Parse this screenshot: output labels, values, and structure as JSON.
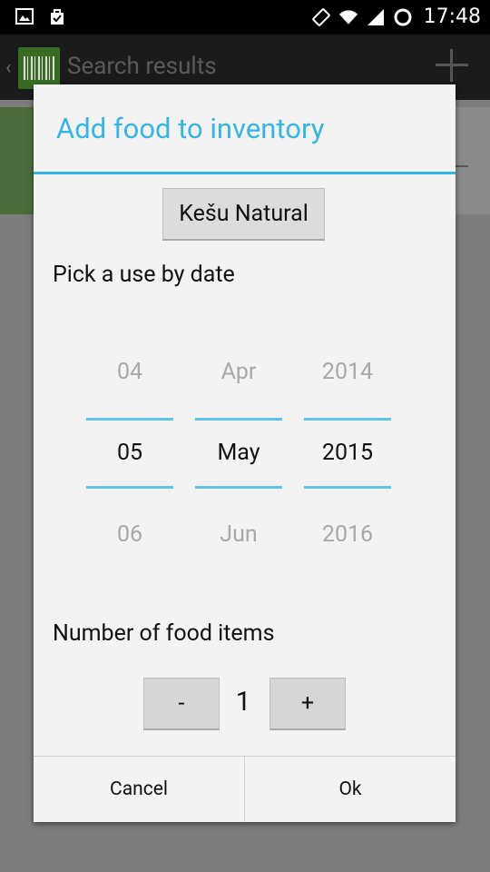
{
  "status_bar": {
    "time": "17:48",
    "icons": [
      "image-icon",
      "shopping-bag-icon",
      "screen-rotate-icon",
      "wifi-icon",
      "signal-icon",
      "sync-icon"
    ]
  },
  "action_bar": {
    "title": "Search results",
    "icons": [
      "back-icon",
      "barcode-logo-icon",
      "add-icon"
    ]
  },
  "dialog": {
    "title": "Add food to inventory",
    "food_button_label": "Kešu Natural",
    "date_label": "Pick a use by date",
    "date_picker": {
      "day": {
        "prev": "04",
        "current": "05",
        "next": "06"
      },
      "month": {
        "prev": "Apr",
        "current": "May",
        "next": "Jun"
      },
      "year": {
        "prev": "2014",
        "current": "2015",
        "next": "2016"
      }
    },
    "items_label": "Number of food items",
    "stepper": {
      "minus_label": "-",
      "count": "1",
      "plus_label": "+"
    },
    "cancel_label": "Cancel",
    "ok_label": "Ok"
  },
  "colors": {
    "accent": "#33b5e5",
    "picker_line": "#5ec3e8",
    "dialog_bg": "#f3f3f3"
  }
}
